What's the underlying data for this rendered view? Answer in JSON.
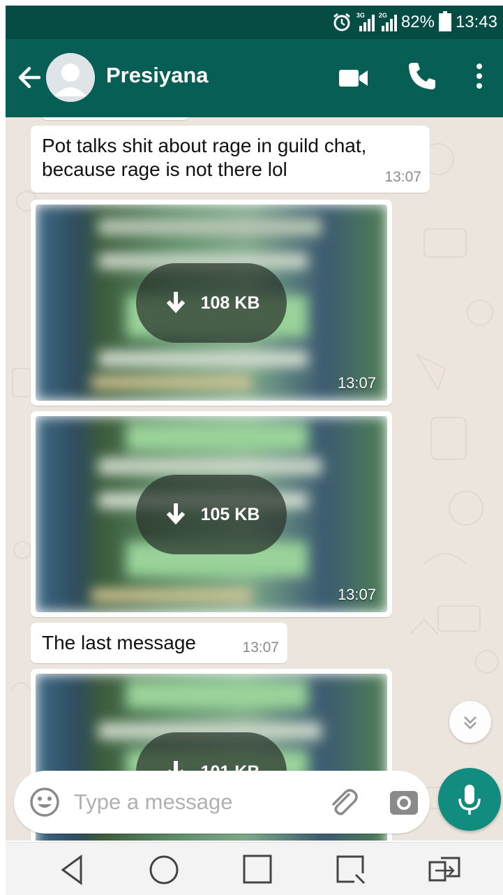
{
  "status_bar": {
    "network_1": "3G",
    "network_2": "2G",
    "battery": "82%",
    "time": "13:43"
  },
  "toolbar": {
    "contact_name": "Presiyana"
  },
  "messages": [
    {
      "type": "text",
      "text_line1": "Pot talks shit about rage in guild chat,",
      "text_line2": "because rage is not there lol",
      "time": "13:07"
    },
    {
      "type": "image",
      "size": "108 KB",
      "time": "13:07"
    },
    {
      "type": "image",
      "size": "105 KB",
      "time": "13:07"
    },
    {
      "type": "text",
      "text": "The last message",
      "time": "13:07"
    },
    {
      "type": "image",
      "size": "101 KB"
    }
  ],
  "composer": {
    "placeholder": "Type a message"
  },
  "colors": {
    "header": "#075e54",
    "status_bar": "#054d44",
    "accent": "#128c7e",
    "chat_background": "#ece5dd"
  },
  "icons": [
    "back-arrow-icon",
    "video-call-icon",
    "phone-icon",
    "more-vert-icon",
    "download-icon",
    "chevron-down-icon",
    "emoji-icon",
    "paperclip-icon",
    "camera-icon",
    "mic-icon",
    "nav-back-icon",
    "nav-home-icon",
    "nav-recents-icon",
    "nav-capture-icon",
    "nav-dual-window-icon"
  ]
}
